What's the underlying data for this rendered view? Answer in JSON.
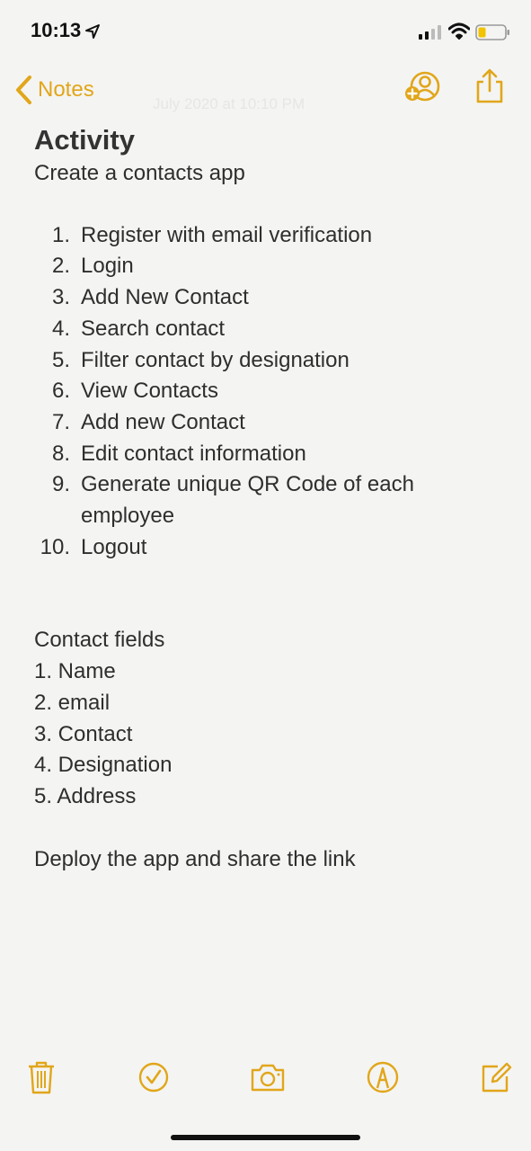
{
  "status_bar": {
    "time": "10:13",
    "icons": [
      "location-arrow-icon",
      "cellular-signal-icon",
      "wifi-icon",
      "battery-icon"
    ]
  },
  "nav": {
    "back_label": "Notes",
    "faded_date": "July 2020 at 10:10 PM",
    "icons": [
      "add-person-icon",
      "share-icon"
    ]
  },
  "note": {
    "title": "Activity",
    "subtitle": "Create a contacts app",
    "steps": [
      {
        "num": "1.",
        "text": "Register with email verification"
      },
      {
        "num": "2.",
        "text": "Login"
      },
      {
        "num": "3.",
        "text": "Add New Contact"
      },
      {
        "num": "4.",
        "text": "Search contact"
      },
      {
        "num": "5.",
        "text": "Filter contact by designation"
      },
      {
        "num": "6.",
        "text": "View Contacts"
      },
      {
        "num": "7.",
        "text": "Add new Contact"
      },
      {
        "num": "8.",
        "text": "Edit contact information"
      },
      {
        "num": "9.",
        "text": "Generate unique QR Code of each employee"
      },
      {
        "num": "10.",
        "text": "Logout"
      }
    ],
    "fields_heading": "Contact fields",
    "fields": [
      "1. Name",
      "2. email",
      "3. Contact",
      "4. Designation",
      "5. Address"
    ],
    "footer": "Deploy the app and share the link"
  },
  "toolbar": {
    "icons": [
      "trash-icon",
      "checklist-icon",
      "camera-icon",
      "markup-pen-icon",
      "compose-icon"
    ]
  },
  "colors": {
    "accent": "#e1a61a",
    "background": "#f4f4f2",
    "text": "#2e2e2e"
  }
}
